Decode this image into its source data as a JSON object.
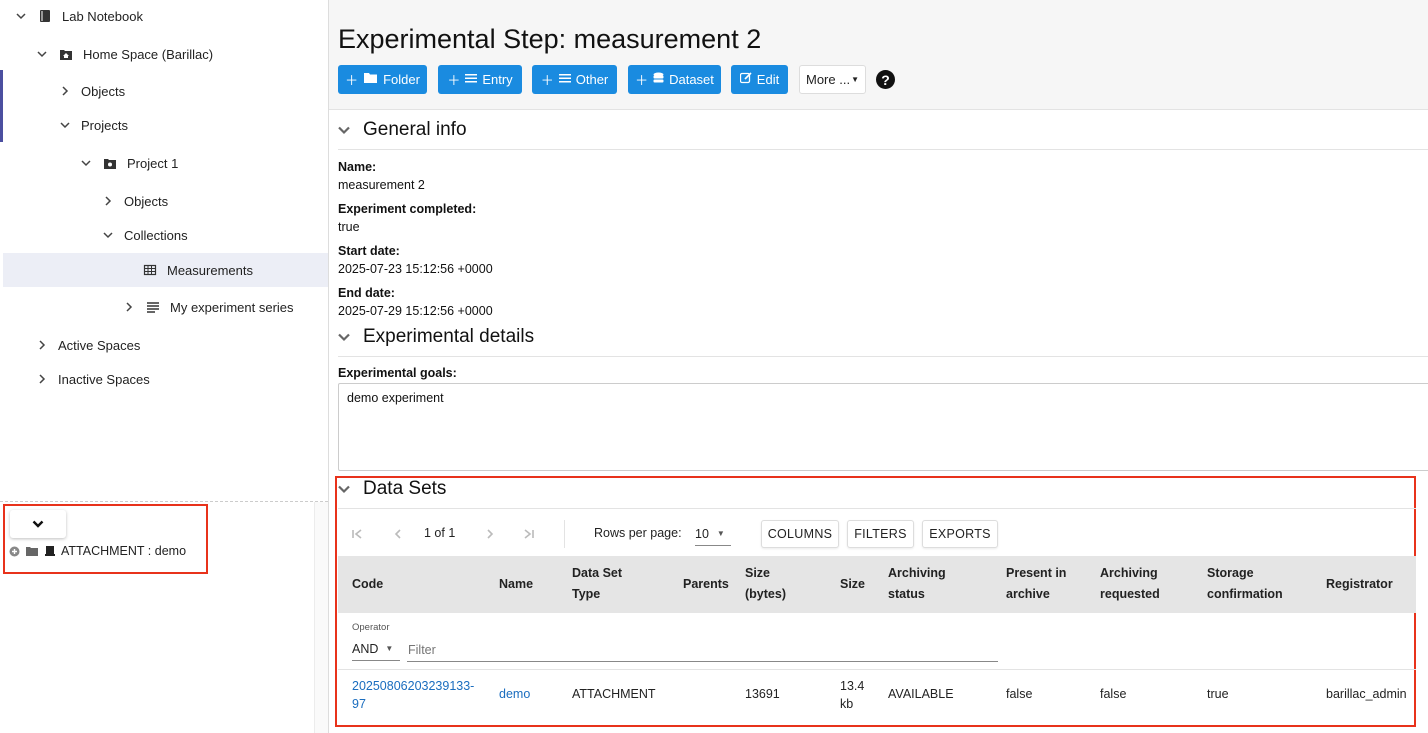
{
  "tree": {
    "lab_notebook": "Lab Notebook",
    "home_space": "Home Space (Barillac)",
    "objects": "Objects",
    "projects": "Projects",
    "project1": "Project 1",
    "project1_objects": "Objects",
    "collections": "Collections",
    "measurements": "Measurements",
    "experiment_series": "My experiment series",
    "active_spaces": "Active Spaces",
    "inactive_spaces": "Inactive Spaces"
  },
  "attachment_panel": {
    "item_label": "ATTACHMENT : demo"
  },
  "header": {
    "title": "Experimental Step: measurement 2",
    "buttons": {
      "folder": "Folder",
      "entry": "Entry",
      "other": "Other",
      "dataset": "Dataset",
      "edit": "Edit",
      "more": "More ..."
    },
    "help": "?"
  },
  "general_info": {
    "heading": "General info",
    "name_label": "Name:",
    "name_value": "measurement 2",
    "completed_label": "Experiment completed:",
    "completed_value": "true",
    "start_label": "Start date:",
    "start_value": "2025-07-23 15:12:56 +0000",
    "end_label": "End date:",
    "end_value": "2025-07-29 15:12:56 +0000"
  },
  "experimental_details": {
    "heading": "Experimental details",
    "goals_label": "Experimental goals:",
    "goals_value": "demo experiment"
  },
  "data_sets": {
    "heading": "Data Sets",
    "page_info": "1 of 1",
    "rows_per_page_label": "Rows per page:",
    "rows_per_page_value": "10",
    "columns_btn": "COLUMNS",
    "filters_btn": "FILTERS",
    "exports_btn": "EXPORTS",
    "columns": {
      "code": "Code",
      "name": "Name",
      "type_line1": "Data Set",
      "type_line2": "Type",
      "parents": "Parents",
      "size_bytes_line1": "Size",
      "size_bytes_line2": "(bytes)",
      "size": "Size",
      "arch_status_line1": "Archiving",
      "arch_status_line2": "status",
      "present_line1": "Present in",
      "present_line2": "archive",
      "arch_req_line1": "Archiving",
      "arch_req_line2": "requested",
      "storage_line1": "Storage",
      "storage_line2": "confirmation",
      "registrator": "Registrator"
    },
    "filter": {
      "operator_label": "Operator",
      "operator_value": "AND",
      "placeholder": "Filter"
    },
    "rows": [
      {
        "code_line1": "20250806203239133-",
        "code_line2": "97",
        "name": "demo",
        "type": "ATTACHMENT",
        "parents": "",
        "size_bytes": "13691",
        "size_line1": "13.4",
        "size_line2": "kb",
        "archiving_status": "AVAILABLE",
        "present_in_archive": "false",
        "archiving_requested": "false",
        "storage_confirmation": "true",
        "registrator": "barillac_admin"
      }
    ]
  },
  "colors": {
    "primary": "#1a8be0",
    "highlight": "#e8321b",
    "link": "#1a6dbf",
    "selected_bg": "#eceef6"
  }
}
